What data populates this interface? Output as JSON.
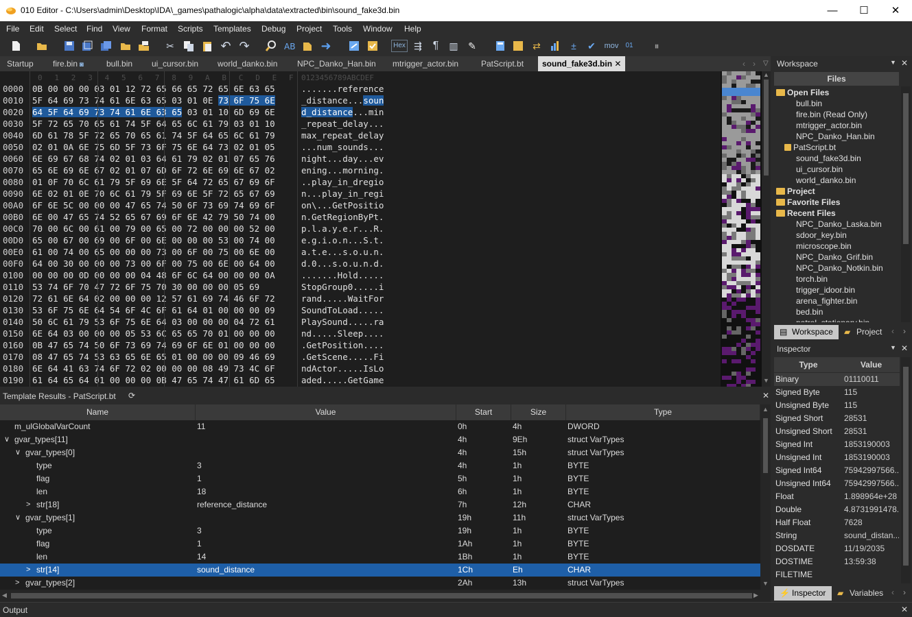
{
  "app": {
    "title": "010 Editor - C:\\Users\\admin\\Desktop\\IDA\\_games\\pathalogic\\alpha\\data\\extracted\\bin\\sound_fake3d.bin",
    "min": "—",
    "max": "☐",
    "close": "✕"
  },
  "menu": [
    "File",
    "Edit",
    "Select",
    "Find",
    "View",
    "Format",
    "Scripts",
    "Templates",
    "Debug",
    "Project",
    "Tools",
    "Window",
    "Help"
  ],
  "toolbar": {
    "hex_label": "Hex",
    "mov_label": "mov"
  },
  "tabs": [
    "Startup",
    "fire.bin",
    "bull.bin",
    "ui_cursor.bin",
    "world_danko.bin",
    "NPC_Danko_Han.bin",
    "mtrigger_actor.bin",
    "PatScript.bt",
    "sound_fake3d.bin"
  ],
  "active_tab_close": "✕",
  "hex": {
    "ruler_hex": [
      "0",
      "1",
      "2",
      "3",
      "4",
      "5",
      "6",
      "7",
      "8",
      "9",
      "A",
      "B",
      "C",
      "D",
      "E",
      "F"
    ],
    "ruler_ascii": "0123456789ABCDEF",
    "rows": [
      {
        "addr": "0000",
        "h": "0B 00 00 00 03 01 12 72 65 66 65 72 65 6E 63 65",
        "a": ".......reference"
      },
      {
        "addr": "0010",
        "h": "5F 64 69 73 74 61 6E 63 65 03 01 0E 73 6F 75 6E",
        "a": "_distance...soun"
      },
      {
        "addr": "0020",
        "h": "64 5F 64 69 73 74 61 6E 63 65 03 01 10 6D 69 6E",
        "a": "d_distance...min"
      },
      {
        "addr": "0030",
        "h": "5F 72 65 70 65 61 74 5F 64 65 6C 61 79 03 01 10",
        "a": "_repeat_delay..."
      },
      {
        "addr": "0040",
        "h": "6D 61 78 5F 72 65 70 65 61 74 5F 64 65 6C 61 79",
        "a": "max_repeat_delay"
      },
      {
        "addr": "0050",
        "h": "02 01 0A 6E 75 6D 5F 73 6F 75 6E 64 73 02 01 05",
        "a": "...num_sounds..."
      },
      {
        "addr": "0060",
        "h": "6E 69 67 68 74 02 01 03 64 61 79 02 01 07 65 76",
        "a": "night...day...ev"
      },
      {
        "addr": "0070",
        "h": "65 6E 69 6E 67 02 01 07 6D 6F 72 6E 69 6E 67 02",
        "a": "ening...morning."
      },
      {
        "addr": "0080",
        "h": "01 0F 70 6C 61 79 5F 69 6E 5F 64 72 65 67 69 6F",
        "a": "..play_in_dregio"
      },
      {
        "addr": "0090",
        "h": "6E 02 01 0E 70 6C 61 79 5F 69 6E 5F 72 65 67 69",
        "a": "n...play_in_regi"
      },
      {
        "addr": "00A0",
        "h": "6F 6E 5C 00 00 00 47 65 74 50 6F 73 69 74 69 6F",
        "a": "on\\...GetPositio"
      },
      {
        "addr": "00B0",
        "h": "6E 00 47 65 74 52 65 67 69 6F 6E 42 79 50 74 00",
        "a": "n.GetRegionByPt."
      },
      {
        "addr": "00C0",
        "h": "70 00 6C 00 61 00 79 00 65 00 72 00 00 00 52 00",
        "a": "p.l.a.y.e.r...R."
      },
      {
        "addr": "00D0",
        "h": "65 00 67 00 69 00 6F 00 6E 00 00 00 53 00 74 00",
        "a": "e.g.i.o.n...S.t."
      },
      {
        "addr": "00E0",
        "h": "61 00 74 00 65 00 00 00 73 00 6F 00 75 00 6E 00",
        "a": "a.t.e...s.o.u.n."
      },
      {
        "addr": "00F0",
        "h": "64 00 30 00 00 00 73 00 6F 00 75 00 6E 00 64 00",
        "a": "d.0...s.o.u.n.d."
      },
      {
        "addr": "0100",
        "h": "00 00 00 0D 00 00 00 04 48 6F 6C 64 00 00 00 0A",
        "a": ".......Hold....."
      },
      {
        "addr": "0110",
        "h": "53 74 6F 70 47 72 6F 75 70 30 00 00 00 05 69",
        "a": "StopGroup0.....i"
      },
      {
        "addr": "0120",
        "h": "72 61 6E 64 02 00 00 00 12 57 61 69 74 46 6F 72",
        "a": "rand.....WaitFor"
      },
      {
        "addr": "0130",
        "h": "53 6F 75 6E 64 54 6F 4C 6F 61 64 01 00 00 00 09",
        "a": "SoundToLoad....."
      },
      {
        "addr": "0140",
        "h": "50 6C 61 79 53 6F 75 6E 64 03 00 00 00 04 72 61",
        "a": "PlaySound.....ra"
      },
      {
        "addr": "0150",
        "h": "6E 64 03 00 00 00 05 53 6C 65 65 70 01 00 00 00",
        "a": "nd.....Sleep...."
      },
      {
        "addr": "0160",
        "h": "0B 47 65 74 50 6F 73 69 74 69 6F 6E 01 00 00 00",
        "a": ".GetPosition...."
      },
      {
        "addr": "0170",
        "h": "08 47 65 74 53 63 65 6E 65 01 00 00 00 09 46 69",
        "a": ".GetScene.....Fi"
      },
      {
        "addr": "0180",
        "h": "6E 64 41 63 74 6F 72 02 00 00 00 08 49 73 4C 6F",
        "a": "ndActor.....IsLo"
      },
      {
        "addr": "0190",
        "h": "61 64 65 64 01 00 00 00 0B 47 65 74 47 61 6D 65",
        "a": "aded.....GetGame"
      }
    ]
  },
  "template_results": {
    "title": "Template Results - PatScript.bt",
    "refresh_icon": "⟳",
    "close": "✕",
    "columns": [
      "Name",
      "Value",
      "Start",
      "Size",
      "Type"
    ],
    "rows": [
      {
        "indent": 0,
        "arrow": "",
        "name": "m_ulGlobalVarCount",
        "value": "11",
        "start": "0h",
        "size": "4h",
        "type": "DWORD"
      },
      {
        "indent": 0,
        "arrow": "∨",
        "name": "gvar_types[11]",
        "value": "",
        "start": "4h",
        "size": "9Eh",
        "type": "struct VarTypes"
      },
      {
        "indent": 1,
        "arrow": "∨",
        "name": "gvar_types[0]",
        "value": "",
        "start": "4h",
        "size": "15h",
        "type": "struct VarTypes"
      },
      {
        "indent": 2,
        "arrow": "",
        "name": "type",
        "value": "3",
        "start": "4h",
        "size": "1h",
        "type": "BYTE"
      },
      {
        "indent": 2,
        "arrow": "",
        "name": "flag",
        "value": "1",
        "start": "5h",
        "size": "1h",
        "type": "BYTE"
      },
      {
        "indent": 2,
        "arrow": "",
        "name": "len",
        "value": "18",
        "start": "6h",
        "size": "1h",
        "type": "BYTE"
      },
      {
        "indent": 2,
        "arrow": ">",
        "name": "str[18]",
        "value": "reference_distance",
        "start": "7h",
        "size": "12h",
        "type": "CHAR"
      },
      {
        "indent": 1,
        "arrow": "∨",
        "name": "gvar_types[1]",
        "value": "",
        "start": "19h",
        "size": "11h",
        "type": "struct VarTypes"
      },
      {
        "indent": 2,
        "arrow": "",
        "name": "type",
        "value": "3",
        "start": "19h",
        "size": "1h",
        "type": "BYTE"
      },
      {
        "indent": 2,
        "arrow": "",
        "name": "flag",
        "value": "1",
        "start": "1Ah",
        "size": "1h",
        "type": "BYTE"
      },
      {
        "indent": 2,
        "arrow": "",
        "name": "len",
        "value": "14",
        "start": "1Bh",
        "size": "1h",
        "type": "BYTE"
      },
      {
        "indent": 2,
        "arrow": ">",
        "name": "str[14]",
        "value": "sound_distance",
        "start": "1Ch",
        "size": "Eh",
        "type": "CHAR",
        "selected": true
      },
      {
        "indent": 1,
        "arrow": ">",
        "name": "gvar_types[2]",
        "value": "",
        "start": "2Ah",
        "size": "13h",
        "type": "struct VarTypes"
      }
    ]
  },
  "workspace": {
    "title": "Workspace",
    "section": "Files",
    "open_files_label": "Open Files",
    "open_files": [
      "bull.bin",
      "fire.bin (Read Only)",
      "mtrigger_actor.bin",
      "NPC_Danko_Han.bin",
      "PatScript.bt",
      "sound_fake3d.bin",
      "ui_cursor.bin",
      "world_danko.bin"
    ],
    "project_label": "Project",
    "favorite_label": "Favorite Files",
    "recent_label": "Recent Files",
    "recent_files": [
      "NPC_Danko_Laska.bin",
      "sdoor_key.bin",
      "microscope.bin",
      "NPC_Danko_Grif.bin",
      "NPC_Danko_Notkin.bin",
      "torch.bin",
      "trigger_idoor.bin",
      "arena_fighter.bin",
      "bed.bin",
      "patrol_stationary.bin"
    ],
    "tab_workspace": "Workspace",
    "tab_project": "Project"
  },
  "inspector": {
    "title": "Inspector",
    "col_type": "Type",
    "col_value": "Value",
    "rows": [
      {
        "k": "Binary",
        "v": "01110011"
      },
      {
        "k": "Signed Byte",
        "v": "115"
      },
      {
        "k": "Unsigned Byte",
        "v": "115"
      },
      {
        "k": "Signed Short",
        "v": "28531"
      },
      {
        "k": "Unsigned Short",
        "v": "28531"
      },
      {
        "k": "Signed Int",
        "v": "1853190003"
      },
      {
        "k": "Unsigned Int",
        "v": "1853190003"
      },
      {
        "k": "Signed Int64",
        "v": "75942997566..."
      },
      {
        "k": "Unsigned Int64",
        "v": "75942997566..."
      },
      {
        "k": "Float",
        "v": "1.898964e+28"
      },
      {
        "k": "Double",
        "v": "4.8731991478..."
      },
      {
        "k": "Half Float",
        "v": "7628"
      },
      {
        "k": "String",
        "v": "sound_distan..."
      },
      {
        "k": "DOSDATE",
        "v": "11/19/2035"
      },
      {
        "k": "DOSTIME",
        "v": "13:59:38"
      },
      {
        "k": "FILETIME",
        "v": ""
      }
    ],
    "tab_inspector": "Inspector",
    "tab_variables": "Variables"
  },
  "output": {
    "title": "Output"
  },
  "colors": {
    "selection": "#1f5a9c",
    "row_highlight": "#1e5fa8",
    "folder": "#e8b84a",
    "minimap_purple": "#5a1a6e"
  }
}
